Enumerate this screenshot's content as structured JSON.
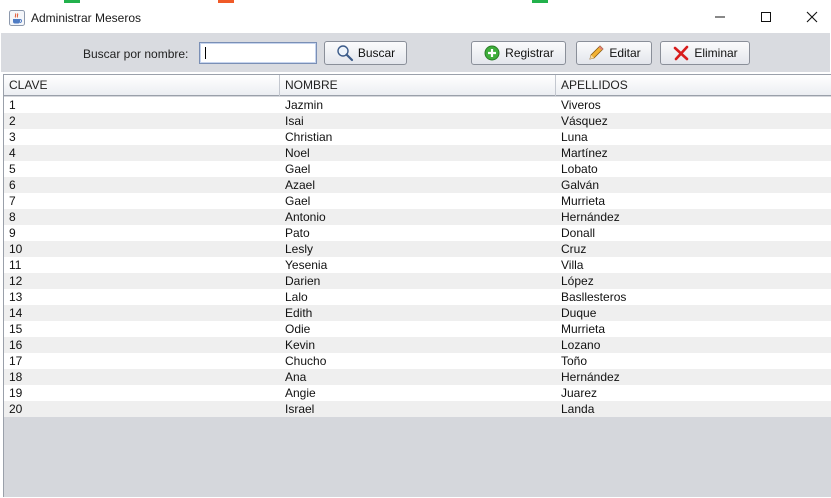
{
  "window": {
    "title": "Administrar Meseros"
  },
  "colors": {
    "strip_green": "#22b14c",
    "strip_orange": "#f05a28",
    "toolbar_bg": "#d9dbe0",
    "table_bg": "#d5d7dc"
  },
  "toolbar": {
    "search_label": "Buscar por nombre:",
    "search_value": "",
    "buscar_label": "Buscar",
    "registrar_label": "Registrar",
    "editar_label": "Editar",
    "eliminar_label": "Eliminar"
  },
  "icons": {
    "app": "java-cup-icon",
    "minimize": "minimize-icon",
    "maximize": "maximize-icon",
    "close": "close-icon",
    "buscar": "magnifier-icon",
    "registrar": "green-plus-icon",
    "editar": "pencil-icon",
    "eliminar": "red-x-icon"
  },
  "table": {
    "columns": [
      "CLAVE",
      "NOMBRE",
      "APELLIDOS"
    ],
    "rows": [
      [
        "1",
        "Jazmin",
        "Viveros"
      ],
      [
        "2",
        "Isai",
        "Vásquez"
      ],
      [
        "3",
        "Christian",
        "Luna"
      ],
      [
        "4",
        "Noel",
        "Martínez"
      ],
      [
        "5",
        "Gael",
        "Lobato"
      ],
      [
        "6",
        "Azael",
        "Galván"
      ],
      [
        "7",
        "Gael",
        "Murrieta"
      ],
      [
        "8",
        "Antonio",
        "Hernández"
      ],
      [
        "9",
        "Pato",
        "Donall"
      ],
      [
        "10",
        "Lesly",
        "Cruz"
      ],
      [
        "11",
        "Yesenia",
        "Villa"
      ],
      [
        "12",
        "Darien",
        "López"
      ],
      [
        "13",
        "Lalo",
        "Basllesteros"
      ],
      [
        "14",
        "Edith",
        "Duque"
      ],
      [
        "15",
        "Odie",
        "Murrieta"
      ],
      [
        "16",
        "Kevin",
        "Lozano"
      ],
      [
        "17",
        "Chucho",
        "Toño"
      ],
      [
        "18",
        "Ana",
        "Hernández"
      ],
      [
        "19",
        "Angie",
        "Juarez"
      ],
      [
        "20",
        "Israel",
        "Landa"
      ]
    ]
  }
}
